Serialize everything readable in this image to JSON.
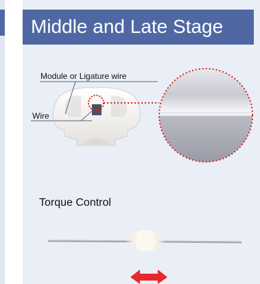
{
  "panel": {
    "title": "Middle and Late Stage"
  },
  "diagram": {
    "module_label": "Module or Ligature wire",
    "wire_label": "Wire"
  },
  "torque": {
    "label": "Torque Control",
    "arrow_icon": "double-arrow-icon",
    "arrow_color": "#e8282b"
  },
  "colors": {
    "header": "#4f68a3",
    "panel_bg": "#eaeef7",
    "callout": "#d62020"
  }
}
